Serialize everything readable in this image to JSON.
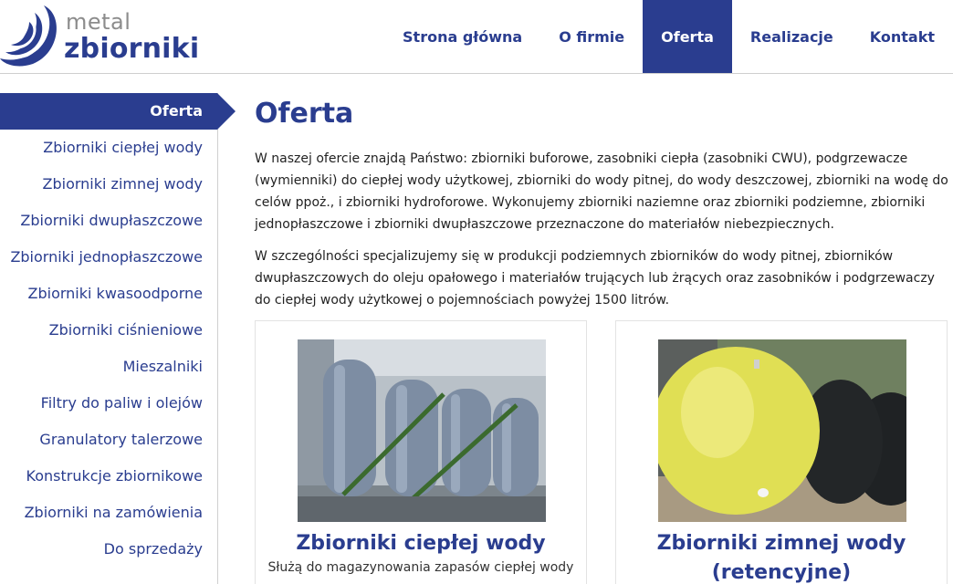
{
  "logo": {
    "top": "metal",
    "bottom": "zbiorniki"
  },
  "nav": [
    {
      "label": "Strona główna",
      "active": false
    },
    {
      "label": "O firmie",
      "active": false
    },
    {
      "label": "Oferta",
      "active": true
    },
    {
      "label": "Realizacje",
      "active": false
    },
    {
      "label": "Kontakt",
      "active": false
    }
  ],
  "sidebar": {
    "active_label": "Oferta",
    "items": [
      "Zbiorniki ciepłej wody",
      "Zbiorniki zimnej wody",
      "Zbiorniki dwupłaszczowe",
      "Zbiorniki jednopłaszczowe",
      "Zbiorniki kwasoodporne",
      "Zbiorniki ciśnieniowe",
      "Mieszalniki",
      "Filtry do paliw i olejów",
      "Granulatory talerzowe",
      "Konstrukcje zbiornikowe",
      "Zbiorniki na zamówienia",
      "Do sprzedaży"
    ]
  },
  "main": {
    "title": "Oferta",
    "paragraphs": [
      "W naszej ofercie znajdą Państwo: zbiorniki buforowe, zasobniki ciepła (zasobniki CWU), podgrzewacze (wymienniki) do ciepłej wody użytkowej, zbiorniki do wody pitnej, do wody deszczowej, zbiorniki na wodę do celów ppoż., i zbiorniki hydroforowe. Wykonujemy zbiorniki naziemne oraz zbiorniki podziemne, zbiorniki jednopłaszczowe i zbiorniki dwupłaszczowe przeznaczone do materiałów niebezpiecznych.",
      "W szczególności specjalizujemy się w produkcji podziemnych zbiorników do wody pitnej, zbiorników dwupłaszczowych do oleju opałowego i materiałów trujących lub żrących oraz zasobników i podgrzewaczy do ciepłej wody użytkowej o pojemnościach powyżej 1500 litrów."
    ],
    "cards": [
      {
        "title": "Zbiorniki ciepłej wody",
        "desc": "Służą do magazynowania zapasów ciepłej wody"
      },
      {
        "title": "Zbiorniki zimnej wody (retencyjne)",
        "desc": ""
      }
    ]
  },
  "colors": {
    "brand": "#2a3d8f",
    "border": "#cfcfcf"
  }
}
